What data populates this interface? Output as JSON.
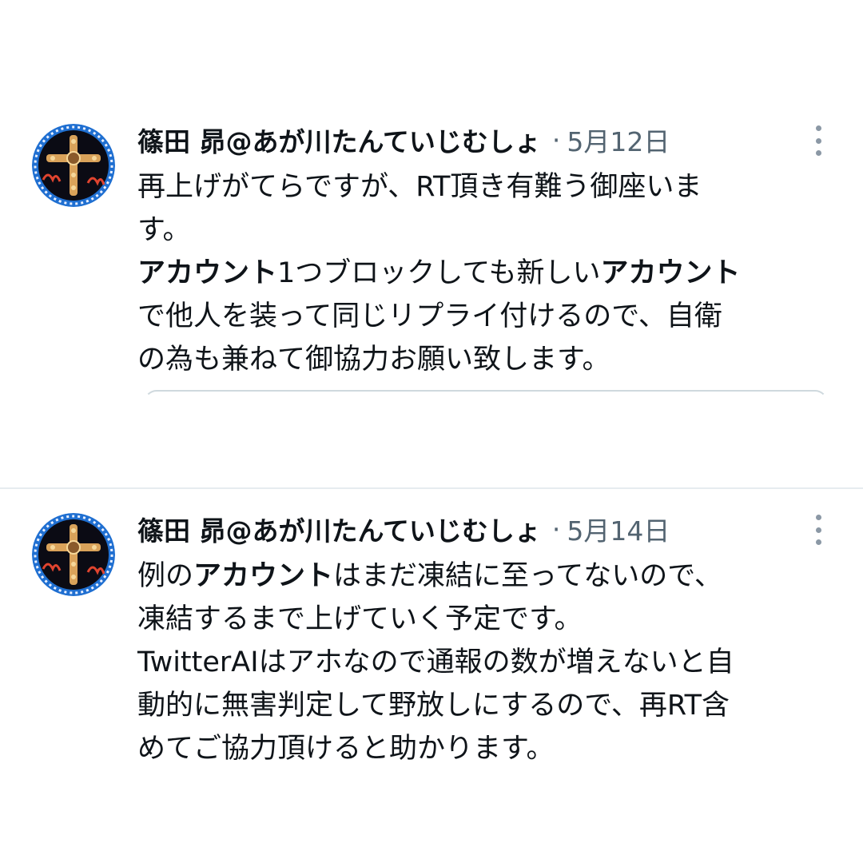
{
  "tweets": [
    {
      "author": "篠田 昴@あが川たんていじむしょ",
      "separator": "·",
      "date": "5月12日",
      "lines": [
        [
          {
            "t": "再上げがてらですが、RT頂き有難う御座いま",
            "b": false
          }
        ],
        [
          {
            "t": "す。",
            "b": false
          }
        ],
        [
          {
            "t": "アカウント",
            "b": true
          },
          {
            "t": "1つブロックしても新しい",
            "b": false
          },
          {
            "t": "アカウント",
            "b": true
          }
        ],
        [
          {
            "t": "で他人を装って同じリプライ付けるので、自衛",
            "b": false
          }
        ],
        [
          {
            "t": "の為も兼ねて御協力お願い致します。",
            "b": false
          }
        ]
      ]
    },
    {
      "author": "篠田 昴@あが川たんていじむしょ",
      "separator": "·",
      "date": "5月14日",
      "lines": [
        [
          {
            "t": "例の",
            "b": false
          },
          {
            "t": "アカウント",
            "b": true
          },
          {
            "t": "はまだ凍結に至ってないので、",
            "b": false
          }
        ],
        [
          {
            "t": "凍結するまで上げていく予定です。",
            "b": false
          }
        ],
        [
          {
            "t": "TwitterAIはアホなので通報の数が増えないと自",
            "b": false
          }
        ],
        [
          {
            "t": "動的に無害判定して野放しにするので、再RT含",
            "b": false
          }
        ],
        [
          {
            "t": "めてご協力頂けると助かります。",
            "b": false
          }
        ]
      ]
    }
  ],
  "icons": {
    "avatar": "avatar-cross-emblem",
    "more": "more-vertical-icon"
  },
  "colors": {
    "text": "#0f1419",
    "secondary": "#536471",
    "divider": "#e6ecf0",
    "card_border": "#cfd9de"
  }
}
